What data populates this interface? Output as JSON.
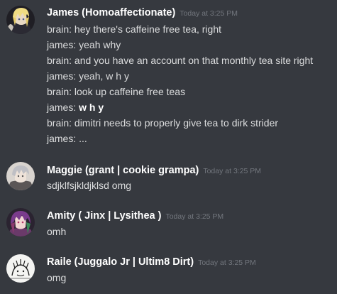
{
  "messages": [
    {
      "username": "James (Homoaffectionate)",
      "timestamp": "Today at 3:25 PM",
      "avatar_icon": "blonde-anime-character-avatar",
      "lines": [
        "brain: hey there's caffeine free tea, right",
        "james: yeah why",
        "brain: and you have an account on that monthly tea site right",
        "james: yeah, w h y",
        "brain: look up caffeine free teas",
        {
          "prefix": "james: ",
          "bold": "w h y"
        },
        "brain: dimitri needs to properly give tea to dirk strider",
        "james: ..."
      ]
    },
    {
      "username": "Maggie (grant | cookie grampa)",
      "timestamp": "Today at 3:25 PM",
      "avatar_icon": "silver-haired-character-avatar",
      "lines": [
        "sdjklfsjkldjklsd omg"
      ]
    },
    {
      "username": "Amity ( Jinx | Lysithea )",
      "timestamp": "Today at 3:25 PM",
      "avatar_icon": "purple-haired-character-avatar",
      "lines": [
        "omh"
      ]
    },
    {
      "username": "Raile (Juggalo Jr | Ultim8 Dirt)",
      "timestamp": "Today at 3:25 PM",
      "avatar_icon": "sketch-drawing-avatar",
      "lines": [
        "omg"
      ]
    }
  ],
  "colors": {
    "background": "#36393f",
    "username": "#ffffff",
    "timestamp": "#72767d",
    "message_text": "#dcddde"
  }
}
